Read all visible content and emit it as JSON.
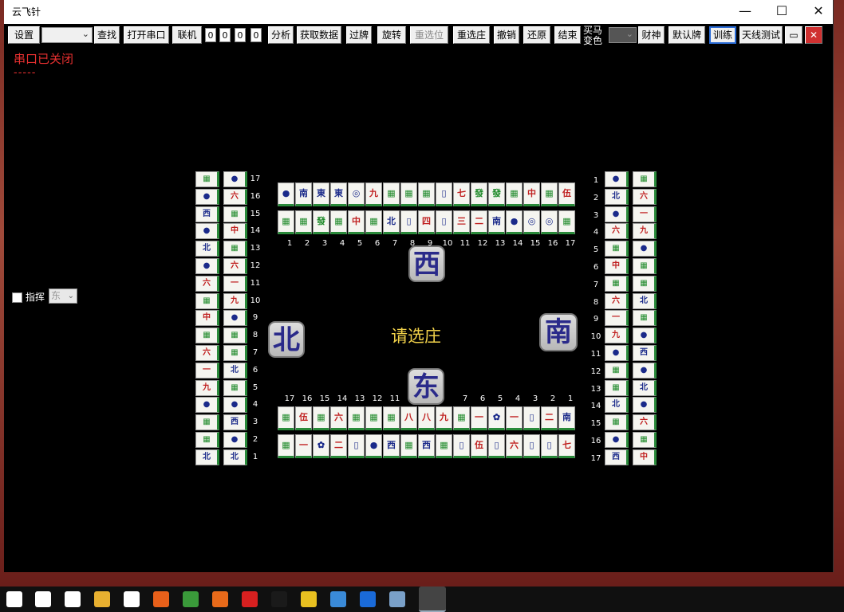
{
  "window": {
    "title": "云飞针",
    "minimize": "—",
    "maximize": "☐",
    "close": "✕"
  },
  "toolbar": {
    "settings": "设置",
    "find": "查找",
    "open_port": "打开串口",
    "connect": "联机",
    "nums": [
      "0",
      "0",
      "0",
      "0"
    ],
    "analyze": "分析",
    "fetch": "获取数据",
    "pass": "过牌",
    "rotate": "旋转",
    "reselect_pos": "重选位",
    "reselect_dealer": "重选庄",
    "undo": "撤销",
    "restore": "还原",
    "end": "结束",
    "maima_line1": "买马",
    "maima_line2": "变色",
    "caishen": "财神",
    "default_tiles": "默认牌",
    "train": "训练",
    "antenna_test": "天线测试"
  },
  "status": {
    "port": "串口已关闭",
    "dashes": "-----"
  },
  "command": {
    "label": "指挥",
    "direction": "东"
  },
  "board": {
    "prompt": "请选庄",
    "winds": {
      "west": "西",
      "north": "北",
      "south": "南",
      "east": "东"
    },
    "top_labels": [
      "1",
      "2",
      "3",
      "4",
      "5",
      "6",
      "7",
      "8",
      "9",
      "10",
      "11",
      "12",
      "13",
      "14",
      "15",
      "16",
      "17"
    ],
    "bottom_labels": [
      "17",
      "16",
      "15",
      "14",
      "13",
      "12",
      "11",
      "7",
      "6",
      "5",
      "4",
      "3",
      "2",
      "1"
    ],
    "left_labels": [
      "17",
      "16",
      "15",
      "14",
      "13",
      "12",
      "11",
      "10",
      "9",
      "8",
      "7",
      "6",
      "5",
      "4",
      "3",
      "2",
      "1"
    ],
    "right_labels": [
      "1",
      "2",
      "3",
      "4",
      "5",
      "6",
      "7",
      "8",
      "9",
      "10",
      "11",
      "12",
      "13",
      "14",
      "15",
      "16",
      "17"
    ],
    "top_row1": [
      "●",
      "南",
      "東",
      "東",
      "◎",
      "九",
      "▦",
      "▦",
      "▦",
      "▯",
      "七",
      "發",
      "發",
      "▦",
      "中",
      "▦",
      "伍"
    ],
    "top_row2": [
      "▦",
      "▦",
      "發",
      "▦",
      "中",
      "▦",
      "北",
      "▯",
      "四",
      "▯",
      "三",
      "二",
      "南",
      "●",
      "◎",
      "◎",
      "▦"
    ],
    "bot_row1": [
      "▦",
      "伍",
      "▦",
      "六",
      "▦",
      "▦",
      "▦",
      "八",
      "八",
      "九",
      "▦",
      "一",
      "✿",
      "一",
      "▯",
      "二",
      "南"
    ],
    "bot_row2": [
      "▦",
      "一",
      "✿",
      "二",
      "▯",
      "●",
      "西",
      "▦",
      "西",
      "▦",
      "▯",
      "伍",
      "▯",
      "六",
      "▯",
      "▯",
      "七"
    ]
  },
  "taskbar": {
    "icons": [
      "windows-start-icon",
      "chat-icon",
      "task-view-icon",
      "file-explorer-icon",
      "store-icon",
      "firefox-icon",
      "chrome-icon",
      "app-orange-icon",
      "app-red-icon",
      "qq-icon",
      "app-yellow-icon",
      "app-blue-icon",
      "app-q-icon",
      "app-image-icon",
      "app-active-icon"
    ]
  }
}
